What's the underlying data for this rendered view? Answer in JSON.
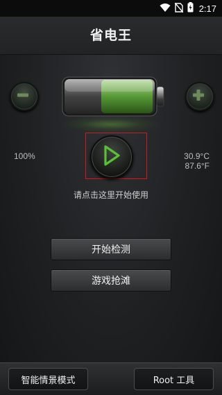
{
  "status_bar": {
    "time": "2:17"
  },
  "app": {
    "title": "省电王"
  },
  "battery": {
    "level": "100%",
    "temp_c": "30.9°C",
    "temp_f": "87.6°F"
  },
  "hint_text": "请点击这里开始使用",
  "actions": {
    "start_detect": "开始检测",
    "game_rush": "游戏抢滩"
  },
  "bottom_bar": {
    "smart_mode": "智能情景模式",
    "root_tools": "Root 工具"
  },
  "colors": {
    "accent_green": "#3f9a2a",
    "highlight_red": "#d4191c"
  }
}
